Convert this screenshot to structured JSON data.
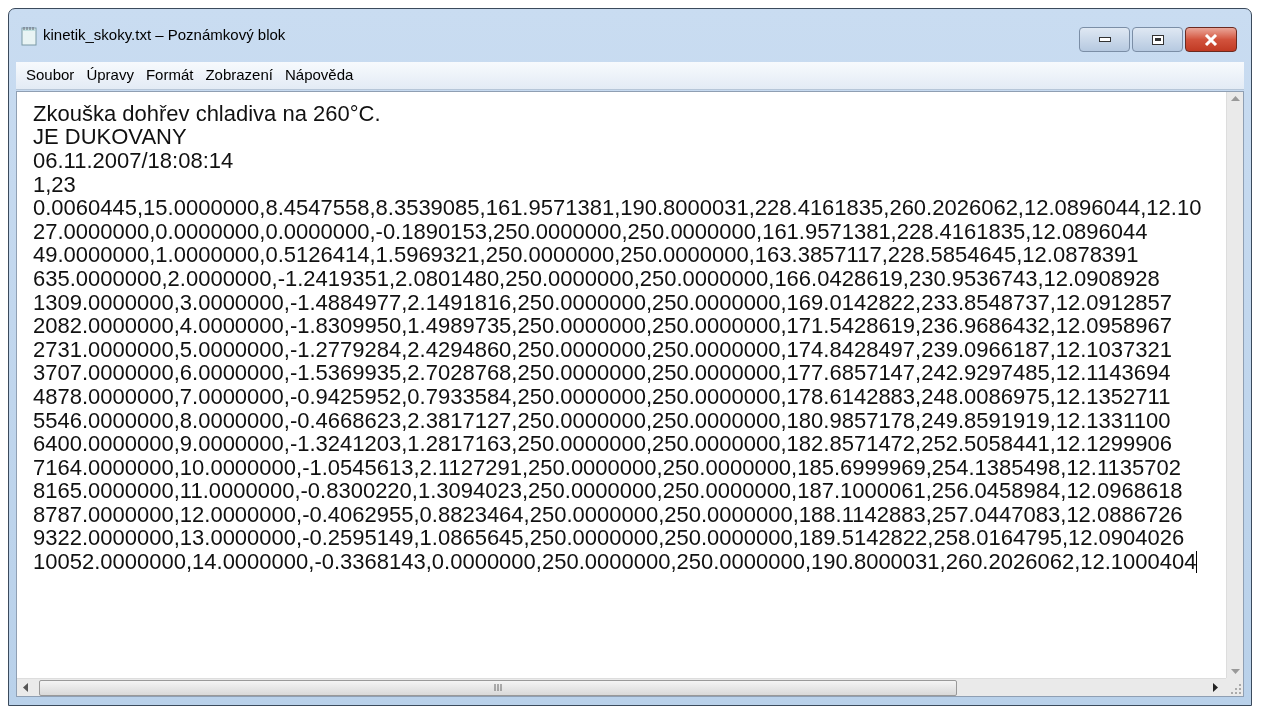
{
  "window": {
    "title": "kinetik_skoky.txt – Poznámkový blok"
  },
  "menu": [
    "Soubor",
    "Úpravy",
    "Formát",
    "Zobrazení",
    "Nápověda"
  ],
  "editor": {
    "caret": true,
    "lines": [
      "Zkouška dohřev chladiva na 260°C.",
      "JE DUKOVANY",
      "06.11.2007/18:08:14",
      "1,23",
      "0.0060445,15.0000000,8.4547558,8.3539085,161.9571381,190.8000031,228.4161835,260.2026062,12.0896044,12.10",
      "27.0000000,0.0000000,0.0000000,-0.1890153,250.0000000,250.0000000,161.9571381,228.4161835,12.0896044",
      "49.0000000,1.0000000,0.5126414,1.5969321,250.0000000,250.0000000,163.3857117,228.5854645,12.0878391",
      "635.0000000,2.0000000,-1.2419351,2.0801480,250.0000000,250.0000000,166.0428619,230.9536743,12.0908928",
      "1309.0000000,3.0000000,-1.4884977,2.1491816,250.0000000,250.0000000,169.0142822,233.8548737,12.0912857",
      "2082.0000000,4.0000000,-1.8309950,1.4989735,250.0000000,250.0000000,171.5428619,236.9686432,12.0958967",
      "2731.0000000,5.0000000,-1.2779284,2.4294860,250.0000000,250.0000000,174.8428497,239.0966187,12.1037321",
      "3707.0000000,6.0000000,-1.5369935,2.7028768,250.0000000,250.0000000,177.6857147,242.9297485,12.1143694",
      "4878.0000000,7.0000000,-0.9425952,0.7933584,250.0000000,250.0000000,178.6142883,248.0086975,12.1352711",
      "5546.0000000,8.0000000,-0.4668623,2.3817127,250.0000000,250.0000000,180.9857178,249.8591919,12.1331100",
      "6400.0000000,9.0000000,-1.3241203,1.2817163,250.0000000,250.0000000,182.8571472,252.5058441,12.1299906",
      "7164.0000000,10.0000000,-1.0545613,2.1127291,250.0000000,250.0000000,185.6999969,254.1385498,12.1135702",
      "8165.0000000,11.0000000,-0.8300220,1.3094023,250.0000000,250.0000000,187.1000061,256.0458984,12.0968618",
      "8787.0000000,12.0000000,-0.4062955,0.8823464,250.0000000,250.0000000,188.1142883,257.0447083,12.0886726",
      "9322.0000000,13.0000000,-0.2595149,1.0865645,250.0000000,250.0000000,189.5142822,258.0164795,12.0904026",
      "10052.0000000,14.0000000,-0.3368143,0.0000000,250.0000000,250.0000000,190.8000031,260.2026062,12.1000404"
    ]
  }
}
